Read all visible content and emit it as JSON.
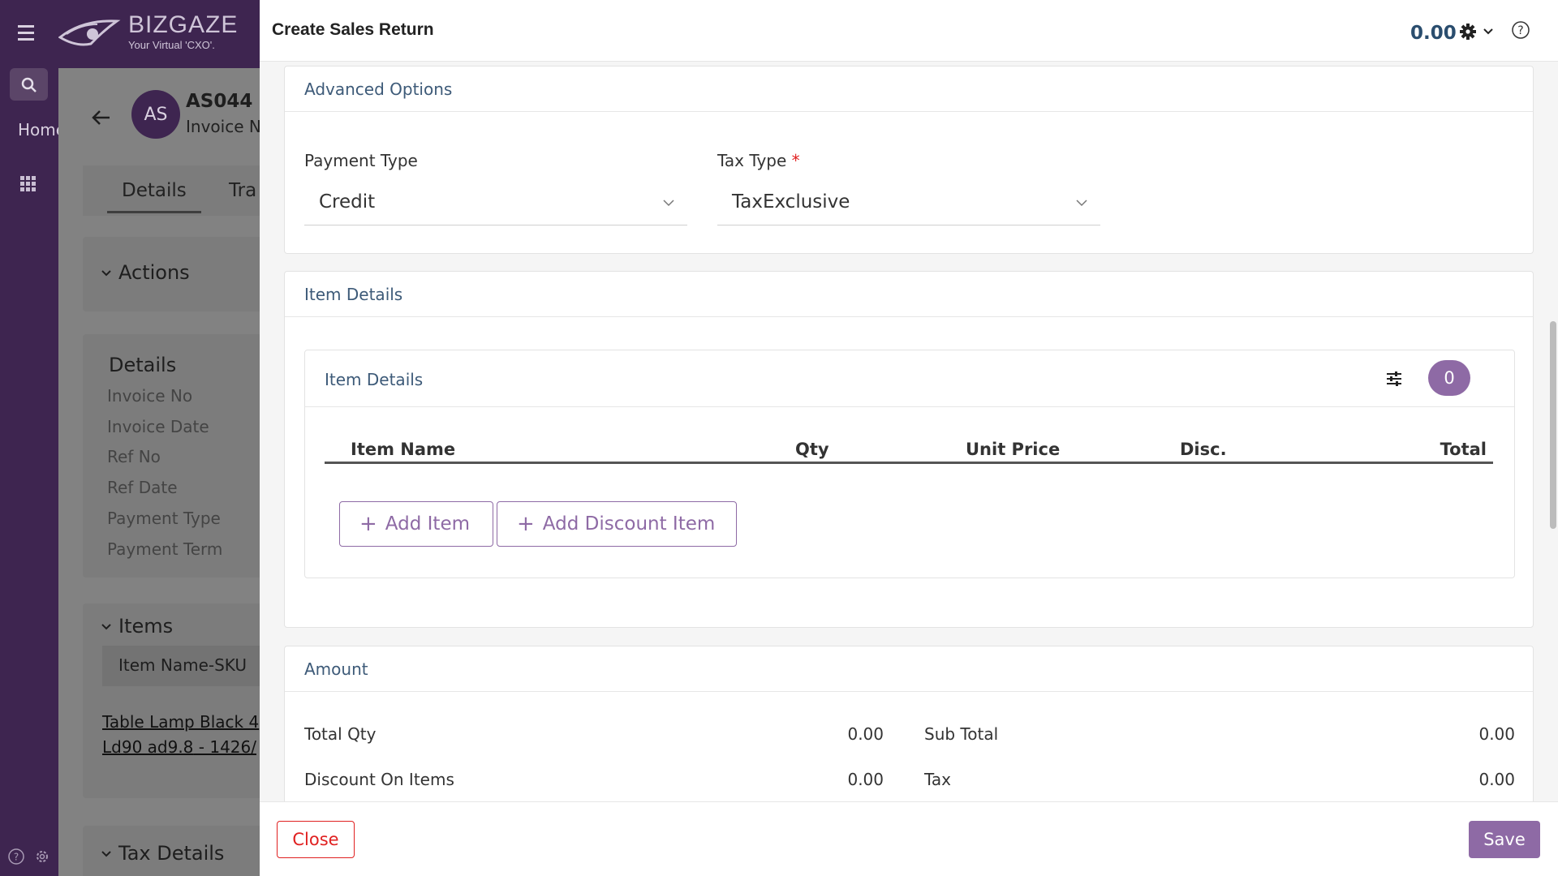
{
  "brand": {
    "name": "BIZGAZE",
    "tagline": "Your Virtual 'CXO'."
  },
  "rail": {
    "home_label": "Home"
  },
  "background_page": {
    "avatar_initials": "AS",
    "record_title": "AS044",
    "record_subtitle": "Invoice N",
    "tabs": [
      "Details",
      "Tra"
    ],
    "actions_title": "Actions",
    "details_title": "Details",
    "details_fields": [
      "Invoice No",
      "Invoice Date",
      "Ref No",
      "Ref Date",
      "Payment Type",
      "Payment Term"
    ],
    "items_title": "Items",
    "items_column": "Item Name-SKU",
    "item_line1": "Table Lamp Black 4",
    "item_line2_link": "Ld90 ad9.8",
    "item_line2_rest": " - 1426/",
    "tax_title": "Tax Details"
  },
  "modal": {
    "title": "Create Sales Return",
    "header_total": "0.00",
    "advanced": {
      "title": "Advanced Options",
      "payment_type_label": "Payment Type",
      "payment_type_value": "Credit",
      "tax_type_label": "Tax Type",
      "tax_type_required": "*",
      "tax_type_value": "TaxExclusive"
    },
    "item_details": {
      "title": "Item Details",
      "sub_title": "Item Details",
      "count": "0",
      "columns": [
        "Item Name",
        "Qty",
        "Unit Price",
        "Disc.",
        "Total"
      ],
      "add_item_label": "Add Item",
      "add_discount_label": "Add Discount Item",
      "plus": "+"
    },
    "amount": {
      "title": "Amount",
      "total_qty_label": "Total Qty",
      "total_qty_value": "0.00",
      "discount_label": "Discount On Items",
      "discount_value": "0.00",
      "sub_total_label": "Sub Total",
      "sub_total_value": "0.00",
      "tax_label": "Tax",
      "tax_value": "0.00"
    },
    "footer": {
      "close_label": "Close",
      "save_label": "Save"
    }
  },
  "colors": {
    "brand_purple": "#3e2550",
    "accent": "#8e6aa5",
    "danger": "#e02020",
    "heading_blue": "#3d5a78"
  }
}
